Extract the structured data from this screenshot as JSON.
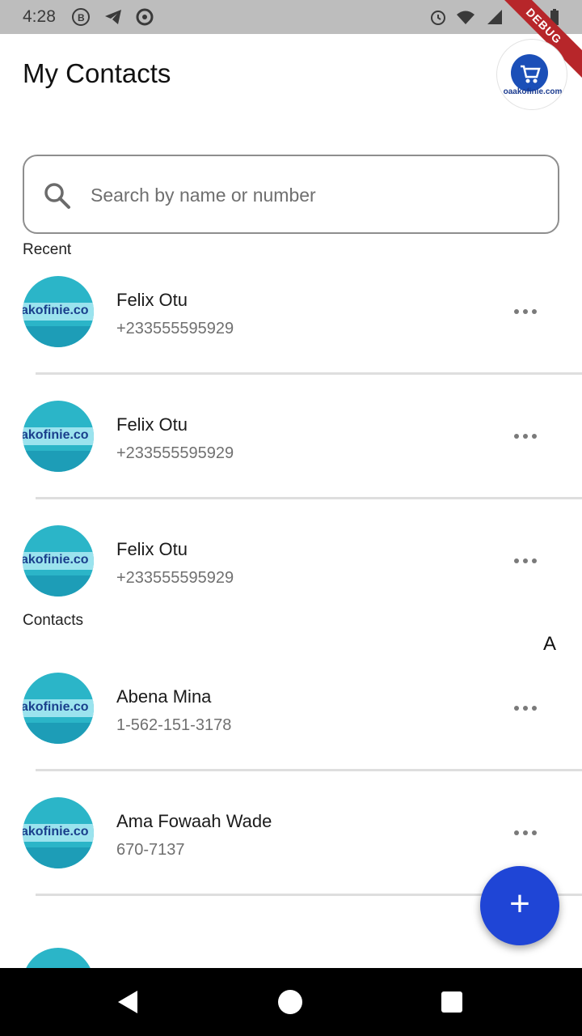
{
  "status_bar": {
    "time": "4:28",
    "ribbon": "DEBUG"
  },
  "header": {
    "title": "My Contacts",
    "logo_text": "oaakofinie.com"
  },
  "search": {
    "placeholder": "Search by name or number",
    "value": ""
  },
  "sections": {
    "recent": "Recent",
    "contacts": "Contacts",
    "index_letter": "A"
  },
  "avatar_text": "akofinie.co",
  "recent": [
    {
      "name": "Felix Otu",
      "phone": "+233555595929"
    },
    {
      "name": "Felix Otu",
      "phone": "+233555595929"
    },
    {
      "name": "Felix Otu",
      "phone": "+233555595929"
    }
  ],
  "contacts": [
    {
      "name": "Abena Mina",
      "phone": "1-562-151-3178"
    },
    {
      "name": "Ama Fowaah Wade",
      "phone": "670-7137"
    }
  ],
  "fab": {
    "label": "+"
  },
  "colors": {
    "accent": "#1f45d6",
    "status_bar": "#bdbdbd",
    "ribbon": "#b7262a"
  },
  "icons": [
    "search-icon",
    "more-icon",
    "back-icon",
    "home-icon",
    "recents-icon",
    "alarm-icon",
    "wifi-icon",
    "battery-icon"
  ]
}
